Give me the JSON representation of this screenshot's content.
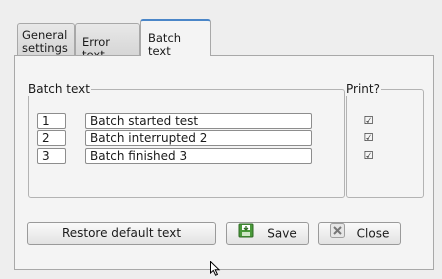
{
  "tabs": [
    {
      "line1": "General",
      "line2": "settings"
    },
    {
      "label": "Error text"
    },
    {
      "label": "Batch text",
      "active": true
    }
  ],
  "batch_group": {
    "title": "Batch text"
  },
  "print_group": {
    "title": "Print?"
  },
  "rows": [
    {
      "number": "1",
      "text": "Batch started test",
      "print": true
    },
    {
      "number": "2",
      "text": "Batch interrupted 2",
      "print": true
    },
    {
      "number": "3",
      "text": "Batch finished 3",
      "print": true
    }
  ],
  "buttons": {
    "restore": "Restore default text",
    "save": "Save",
    "close": "Close"
  },
  "icons": {
    "save": "save-disk-icon",
    "close": "close-x-icon",
    "cursor": "mouse-pointer-icon"
  },
  "colors": {
    "active_tab_accent": "#4a86c8",
    "save_icon_green": "#4a9a3a"
  }
}
